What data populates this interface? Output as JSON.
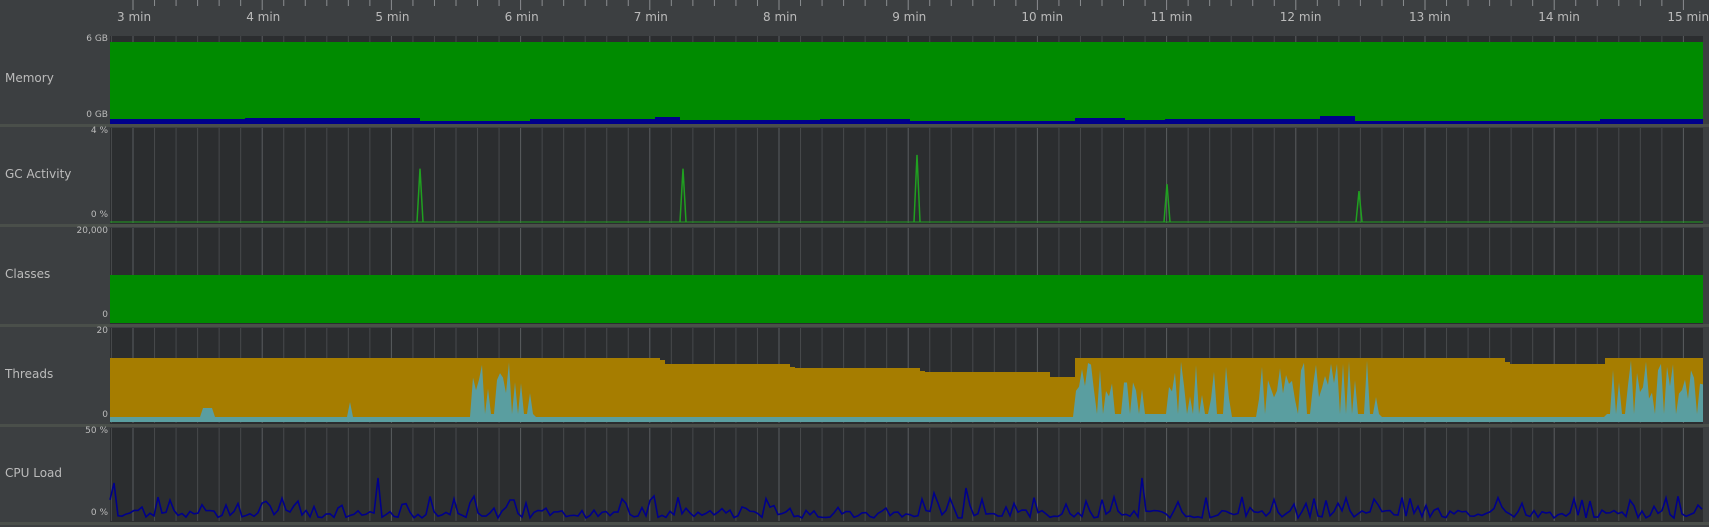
{
  "timeline": {
    "ticks": [
      "3 min",
      "4 min",
      "5 min",
      "6 min",
      "7 min",
      "8 min",
      "9 min",
      "10 min",
      "11 min",
      "12 min",
      "13 min",
      "14 min",
      "15 min"
    ]
  },
  "panels": [
    {
      "id": "memory",
      "label": "Memory",
      "max_label": "6 GB",
      "min_label": "0 GB"
    },
    {
      "id": "gc",
      "label": "GC Activity",
      "max_label": "4 %",
      "min_label": "0 %"
    },
    {
      "id": "classes",
      "label": "Classes",
      "max_label": "20,000",
      "min_label": "0"
    },
    {
      "id": "threads",
      "label": "Threads",
      "max_label": "20",
      "min_label": "0"
    },
    {
      "id": "cpu",
      "label": "CPU Load",
      "max_label": "50 %",
      "min_label": "0 %"
    }
  ],
  "colors": {
    "background": "#3c3f41",
    "plot_background": "#2b2d2f",
    "memory_fill": "#008b00",
    "memory_used": "#00008b",
    "gc_line": "#20a020",
    "classes_fill": "#008b00",
    "threads_fill": "#a67d00",
    "threads_active": "#5a9ea0",
    "cpu_line": "#00008b",
    "separator": "#4a4f4a"
  }
}
